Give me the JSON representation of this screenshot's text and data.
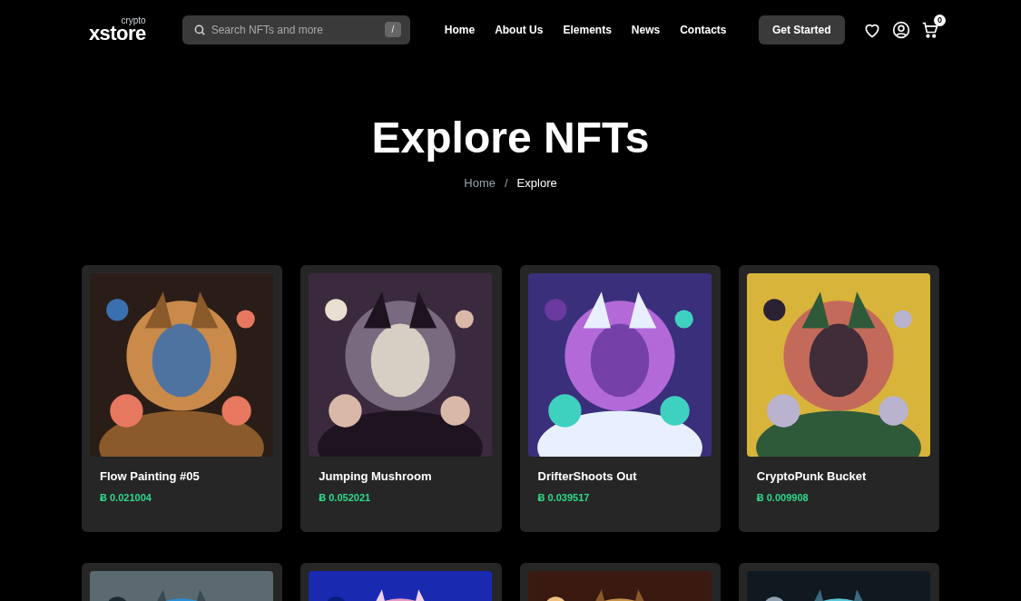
{
  "header": {
    "logo": {
      "name": "xstore",
      "tag": "crypto"
    },
    "search": {
      "placeholder": "Search NFTs and more",
      "shortcut": "/"
    },
    "nav": [
      {
        "label": "Home"
      },
      {
        "label": "About Us"
      },
      {
        "label": "Elements"
      },
      {
        "label": "News"
      },
      {
        "label": "Contacts"
      }
    ],
    "cta": "Get Started",
    "cart_count": "0"
  },
  "hero": {
    "title": "Explore NFTs",
    "breadcrumb": [
      {
        "label": "Home",
        "current": false
      },
      {
        "label": "Explore",
        "current": true
      }
    ],
    "separator": "/"
  },
  "cards": [
    {
      "title": "Flow Painting #05",
      "price": "Ƀ 0.021004",
      "kind": "picture"
    },
    {
      "title": "Jumping Mushroom",
      "price": "Ƀ 0.052021",
      "kind": "picture"
    },
    {
      "title": "DrifterShoots Out",
      "price": "Ƀ 0.039517",
      "kind": "picture"
    },
    {
      "title": "CryptoPunk Bucket",
      "price": "Ƀ 0.009908",
      "kind": "picture"
    },
    {
      "kind": "picture"
    },
    {
      "kind": "picture"
    },
    {
      "kind": "picture"
    },
    {
      "kind": "picture"
    }
  ]
}
